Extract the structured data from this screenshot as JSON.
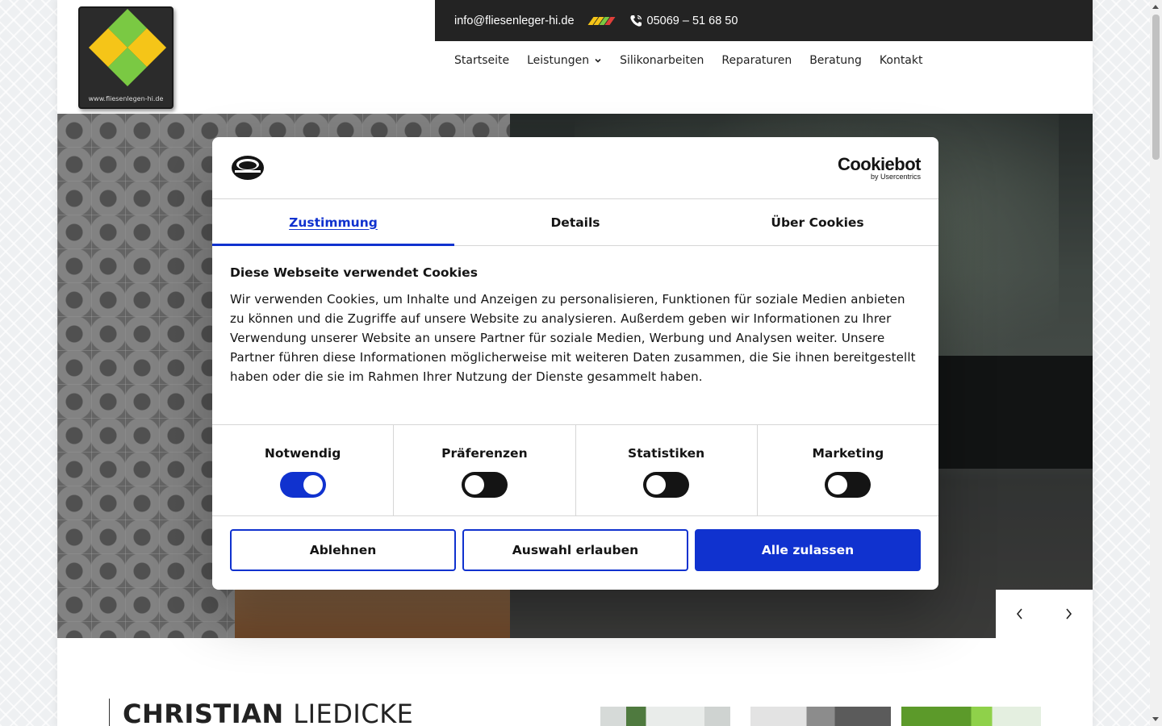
{
  "header": {
    "logo_text": "www.fliesenlegen-hi.de",
    "email": "info@fliesenleger-hi.de",
    "phone": "05069 – 51 68 50",
    "stripe_colors": [
      "#f5c518",
      "#7ac943",
      "#e0403a"
    ],
    "nav": [
      {
        "label": "Startseite"
      },
      {
        "label": "Leistungen",
        "has_dropdown": true
      },
      {
        "label": "Silikonarbeiten"
      },
      {
        "label": "Reparaturen"
      },
      {
        "label": "Beratung"
      },
      {
        "label": "Kontakt"
      }
    ]
  },
  "hero": {
    "prev_icon": "chevron-left-icon",
    "next_icon": "chevron-right-icon"
  },
  "content": {
    "name_first": "CHRISTIAN",
    "name_last": "LIEDICKE"
  },
  "cookie_dialog": {
    "brand": "Cookiebot",
    "brand_sub": "by Usercentrics",
    "tabs": [
      {
        "label": "Zustimmung",
        "active": true
      },
      {
        "label": "Details",
        "active": false
      },
      {
        "label": "Über Cookies",
        "active": false
      }
    ],
    "heading": "Diese Webseite verwendet Cookies",
    "body": "Wir verwenden Cookies, um Inhalte und Anzeigen zu personalisieren, Funktionen für soziale Medien anbieten zu können und die Zugriffe auf unsere Website zu analysieren. Außerdem geben wir Informationen zu Ihrer Verwendung unserer Website an unsere Partner für soziale Medien, Werbung und Analysen weiter. Unsere Partner führen diese Informationen möglicherweise mit weiteren Daten zusammen, die Sie ihnen bereitgestellt haben oder die sie im Rahmen Ihrer Nutzung der Dienste gesammelt haben.",
    "categories": [
      {
        "label": "Notwendig",
        "enabled": true
      },
      {
        "label": "Präferenzen",
        "enabled": false
      },
      {
        "label": "Statistiken",
        "enabled": false
      },
      {
        "label": "Marketing",
        "enabled": false
      }
    ],
    "buttons": {
      "decline": "Ablehnen",
      "allow_selection": "Auswahl erlauben",
      "allow_all": "Alle zulassen"
    },
    "accent_color": "#1032cf"
  }
}
